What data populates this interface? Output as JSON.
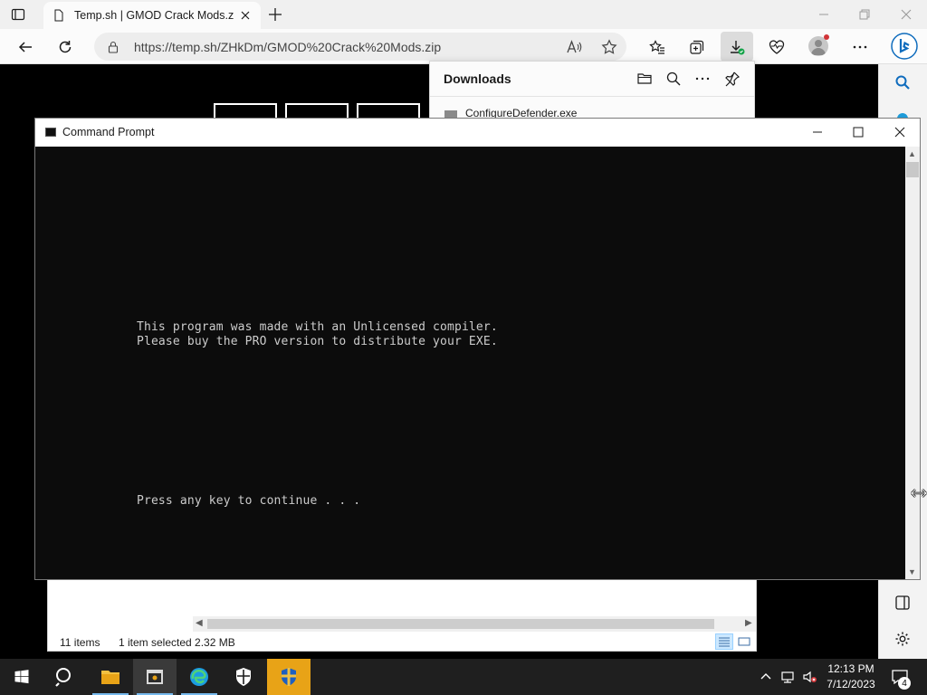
{
  "browser": {
    "tab": {
      "title": "Temp.sh | GMOD Crack Mods.zip"
    },
    "address_bar": {
      "url": "https://temp.sh/ZHkDm/GMOD%20Crack%20Mods.zip"
    }
  },
  "downloads_panel": {
    "title": "Downloads",
    "items": [
      {
        "name": "ConfigureDefender.exe"
      }
    ]
  },
  "cmd_window": {
    "title": "Command Prompt",
    "lines": [
      "This program was made with an Unlicensed compiler.",
      "Please buy the PRO version to distribute your EXE.",
      "Press any key to continue . . ."
    ]
  },
  "explorer": {
    "status": {
      "items": "11 items",
      "selected": "1 item selected  2.32 MB"
    }
  },
  "taskbar": {
    "clock": {
      "time": "12:13 PM",
      "date": "7/12/2023"
    },
    "notifications_count": "4"
  },
  "colors": {
    "cmd_background": "#0c0c0c",
    "cmd_text": "#cccccc",
    "taskbar": "#1f1f1f",
    "edge_accent": "#0078d4",
    "highlight_taskbar": "#e8a317"
  }
}
